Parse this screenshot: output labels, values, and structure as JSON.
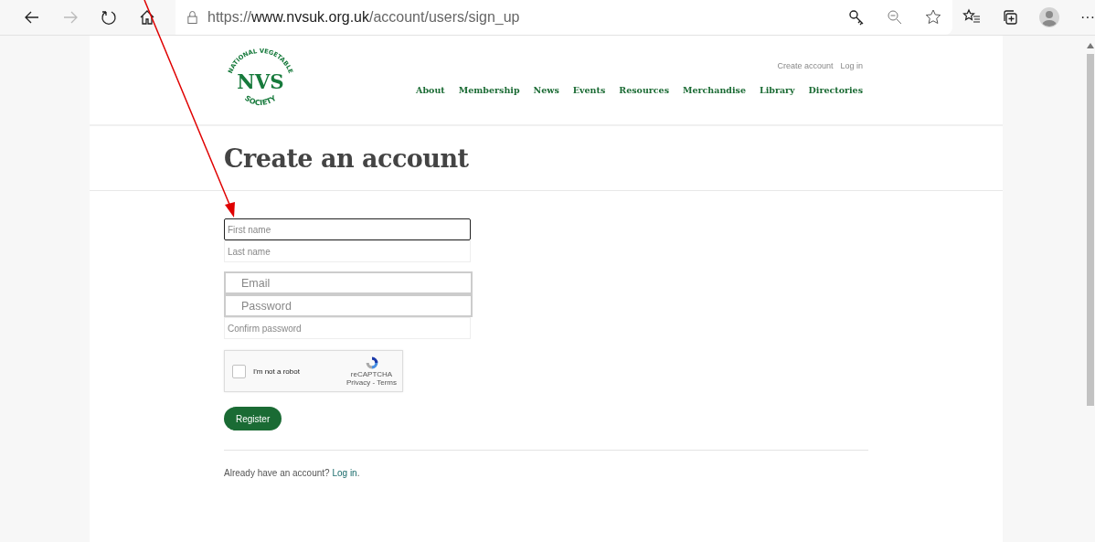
{
  "browser": {
    "url": {
      "scheme": "https://",
      "host": "www.nvsuk.org.uk",
      "path": "/account/users/sign_up"
    },
    "more": "···"
  },
  "logo": {
    "top": "NATIONAL VEGETABLE",
    "middle": "NVS",
    "bottom": "SOCIETY"
  },
  "account_links": [
    "Create account",
    "Log in"
  ],
  "nav": [
    "About",
    "Membership",
    "News",
    "Events",
    "Resources",
    "Merchandise",
    "Library",
    "Directories"
  ],
  "title": "Create an account",
  "fields": [
    {
      "placeholder": "First name",
      "kind": "plain",
      "focused": true
    },
    {
      "placeholder": "Last name",
      "kind": "plain",
      "focused": false
    },
    {
      "placeholder": "Email",
      "kind": "boxed",
      "focused": false
    },
    {
      "placeholder": "Password",
      "kind": "boxed",
      "focused": false
    },
    {
      "placeholder": "Confirm password",
      "kind": "plain",
      "focused": false
    }
  ],
  "captcha": {
    "label": "I'm not a robot",
    "checked": false,
    "brand": "reCAPTCHA",
    "links": "Privacy - Terms"
  },
  "register": "Register",
  "footer": {
    "text": "Already have an account? ",
    "link": "Log in",
    "end": "."
  }
}
